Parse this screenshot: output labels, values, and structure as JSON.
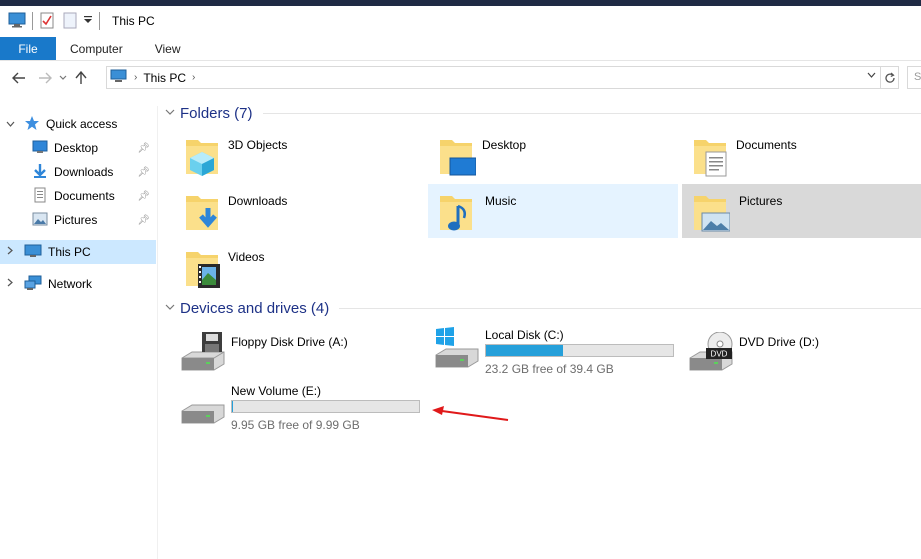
{
  "window": {
    "title": "This PC"
  },
  "ribbon": {
    "tabs": [
      "File",
      "Computer",
      "View"
    ]
  },
  "address": {
    "crumb": "This PC",
    "search_placeholder": "S"
  },
  "nav": {
    "quick_access": "Quick access",
    "pinned": [
      "Desktop",
      "Downloads",
      "Documents",
      "Pictures"
    ],
    "this_pc": "This PC",
    "network": "Network"
  },
  "folders": {
    "header": "Folders (7)",
    "items": [
      "3D Objects",
      "Desktop",
      "Documents",
      "Downloads",
      "Music",
      "Pictures",
      "Videos"
    ]
  },
  "drives": {
    "header": "Devices and drives (4)",
    "items": [
      {
        "name": "Floppy Disk Drive (A:)"
      },
      {
        "name": "Local Disk (C:)",
        "free": "23.2 GB free of 39.4 GB",
        "used_fraction": 0.41
      },
      {
        "name": "DVD Drive (D:)"
      },
      {
        "name": "New Volume (E:)",
        "free": "9.95 GB free of 9.99 GB",
        "used_fraction": 0.004
      }
    ]
  },
  "colors": {
    "accent": "#1979ca",
    "bar_fill": "#26a0da",
    "annotation": "#e0191a",
    "section_title": "#1e3287"
  }
}
